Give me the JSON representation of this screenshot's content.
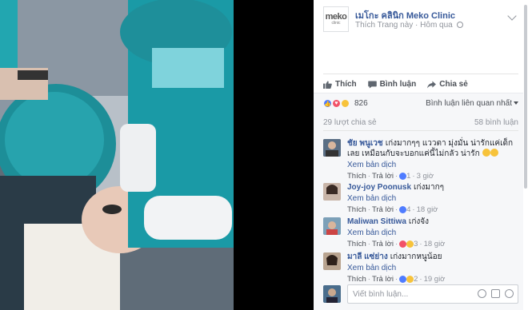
{
  "post": {
    "logo_text": "meko",
    "logo_sub": "clinic",
    "page_name": "เมโกะ คลินิก Meko Clinic",
    "like_page": "Thích Trang này",
    "time": "Hôm qua"
  },
  "actions": {
    "like": "Thích",
    "comment": "Bình luận",
    "share": "Chia sẻ"
  },
  "reactions": {
    "count": "826",
    "sort_label": "Bình luận liên quan nhất",
    "shares": "29 lượt chia sẻ",
    "comments": "58 bình luận",
    "colors": {
      "like": "#4f7cff",
      "love": "#f25268",
      "haha": "#f7c33b"
    }
  },
  "comment_actions": {
    "like": "Thích",
    "reply": "Trả lời",
    "translate": "Xem bản dịch"
  },
  "comments": [
    {
      "name": "ชัย พนูเวช",
      "text": "เก่งมากๆๆ แววตา มุ่งมั่น น่ารักแค่เด็กเลย เหมือนกับจะบอกแค่นี้ไม่กลัว น่ารัก",
      "reacts": "1",
      "time": "3 giờ"
    },
    {
      "name": "Joy-joy Poonusk",
      "text": "เก่งมากๆ",
      "reacts": "4",
      "time": "18 giờ"
    },
    {
      "name": "Maliwan Sittiwa",
      "text": "เก่งจัง",
      "reacts": "3",
      "time": "18 giờ"
    },
    {
      "name": "มาลี แซ่ย่าง",
      "text": "เก่งมากหนูน้อย",
      "reacts": "2",
      "time": "19 giờ"
    }
  ],
  "reply": {
    "placeholder": "Viết bình luận..."
  }
}
